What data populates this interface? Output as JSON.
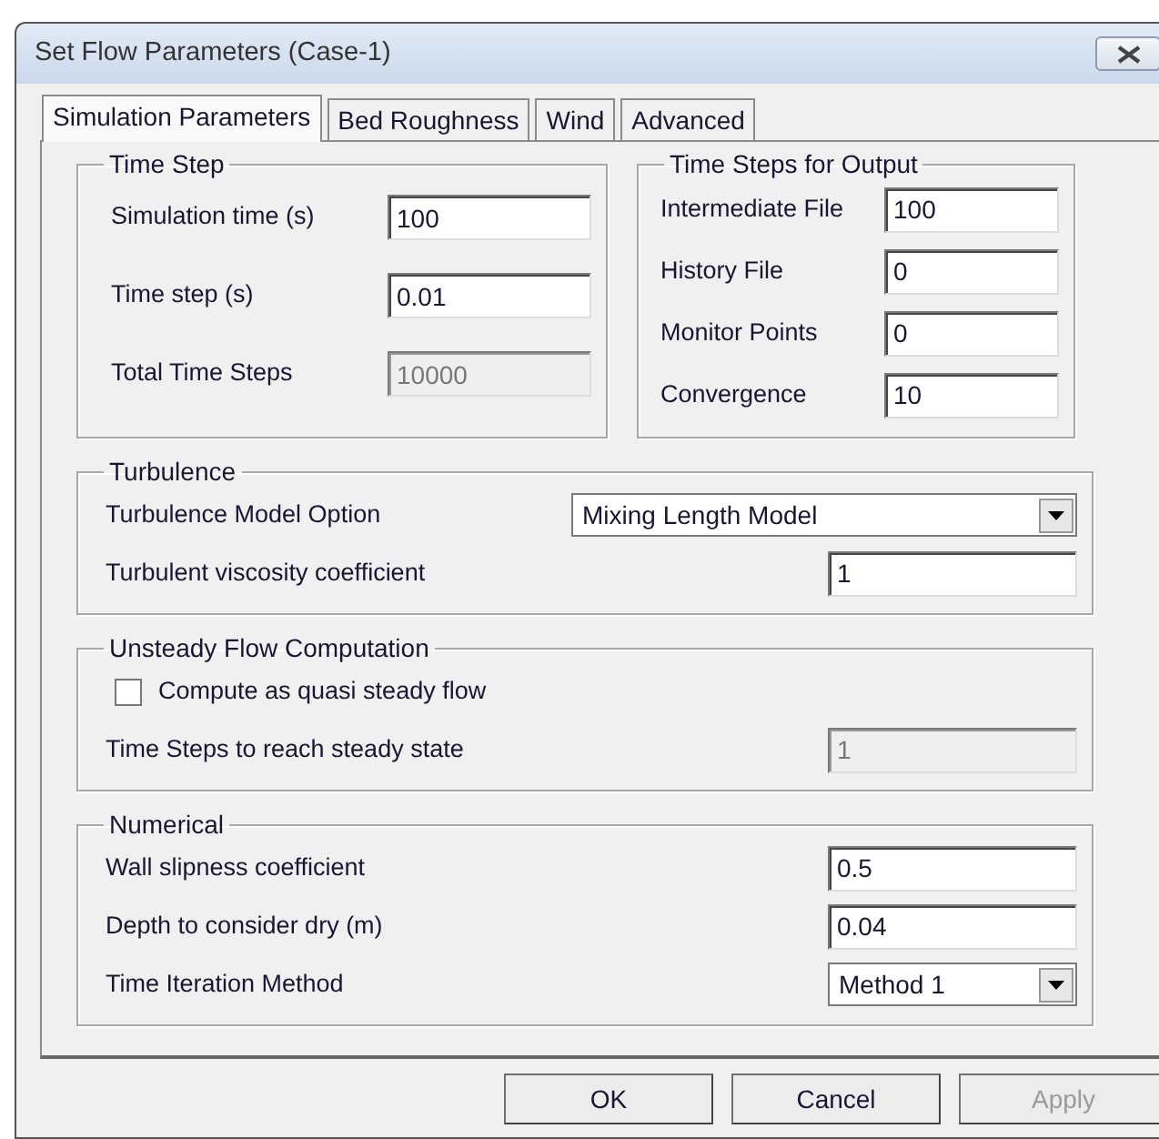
{
  "window": {
    "title": "Set Flow Parameters (Case-1)"
  },
  "tabs": [
    {
      "label": "Simulation Parameters",
      "selected": true
    },
    {
      "label": "Bed Roughness",
      "selected": false
    },
    {
      "label": "Wind",
      "selected": false
    },
    {
      "label": "Advanced",
      "selected": false
    }
  ],
  "top_groups": [
    {
      "title": "Time Step",
      "rows": [
        {
          "kind": "field",
          "label": "Simulation time (s)",
          "value": "100",
          "disabled": false
        },
        {
          "kind": "field",
          "label": "Time step (s)",
          "value": "0.01",
          "disabled": false
        },
        {
          "kind": "field",
          "label": "Total Time Steps",
          "value": "10000",
          "disabled": true
        }
      ]
    },
    {
      "title": "Time Steps for Output",
      "rows": [
        {
          "kind": "field",
          "label": "Intermediate File",
          "value": "100",
          "disabled": false
        },
        {
          "kind": "field",
          "label": "History File",
          "value": "0",
          "disabled": false
        },
        {
          "kind": "field",
          "label": "Monitor Points",
          "value": "0",
          "disabled": false
        },
        {
          "kind": "field",
          "label": "Convergence",
          "value": "10",
          "disabled": false
        }
      ]
    }
  ],
  "groups": [
    {
      "title": "Turbulence",
      "rows": [
        {
          "kind": "dropdown",
          "label": "Turbulence Model Option",
          "value": "Mixing Length Model"
        },
        {
          "kind": "field",
          "label": "Turbulent viscosity coefficient",
          "value": "1",
          "disabled": false
        }
      ]
    },
    {
      "title": "Unsteady Flow Computation",
      "rows": [
        {
          "kind": "checkbox",
          "label": "Compute as quasi steady flow",
          "checked": false
        },
        {
          "kind": "field",
          "label": "Time Steps to reach steady state",
          "value": "1",
          "disabled": true
        }
      ]
    },
    {
      "title": "Numerical",
      "rows": [
        {
          "kind": "field",
          "label": "Wall slipness coefficient",
          "value": "0.5",
          "disabled": false
        },
        {
          "kind": "field",
          "label": "Depth to consider dry (m)",
          "value": "0.04",
          "disabled": false
        },
        {
          "kind": "dropdown",
          "label": "Time Iteration Method",
          "value": "Method 1"
        }
      ]
    }
  ],
  "buttons": [
    {
      "label": "OK",
      "disabled": false
    },
    {
      "label": "Cancel",
      "disabled": false
    },
    {
      "label": "Apply",
      "disabled": true
    }
  ]
}
